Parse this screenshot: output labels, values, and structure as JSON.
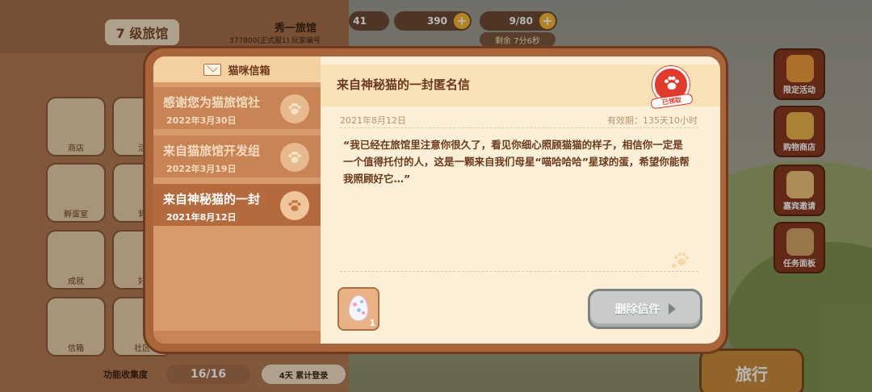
{
  "hud": {
    "hotel_level": "7 级旅馆",
    "player_name": "秀一旅馆",
    "player_id": "377800(正式服1) 玩家编号",
    "res1": "41",
    "fish": "390",
    "tickets": "9/80",
    "remain": "剩余 7分6秒",
    "plus": "+"
  },
  "left_panel": {
    "grid": [
      "商店",
      "活",
      "孵蛋室",
      "背",
      "成就",
      "好",
      "信箱",
      "社区"
    ],
    "collection_label": "功能收集度",
    "collection_value": "16/16",
    "login_label": "4天 累计登录"
  },
  "side_buttons": [
    "限定活动",
    "购物商店",
    "嘉宾邀请",
    "任务面板"
  ],
  "travel_button": "旅行",
  "mailbox": {
    "title": "猫咪信箱",
    "mails": [
      {
        "title": "感谢您为猫旅馆社",
        "date": "2022年3月30日"
      },
      {
        "title": "来自猫旅馆开发组",
        "date": "2022年3月19日"
      },
      {
        "title": "来自神秘猫的一封",
        "date": "2021年8月12日"
      }
    ]
  },
  "letter": {
    "title": "来自神秘猫的一封匿名信",
    "claimed": "已领取",
    "date": "2021年8月12日",
    "validity": "有效期：135天10小时",
    "body": "“我已经在旅馆里注意你很久了，看见你细心照顾猫猫的样子，相信你一定是一个值得托付的人，这是一颗来自我们母星“喵哈哈哈”星球的蛋，希望你能帮我照顾好它…”",
    "attachment_qty": "1",
    "delete_button": "删除信件"
  },
  "colors": {
    "modal_border": "#6f3a1d",
    "paper": "#fcefd7",
    "stamp": "#e03a2a",
    "delete_button": "#c8cbc9"
  }
}
